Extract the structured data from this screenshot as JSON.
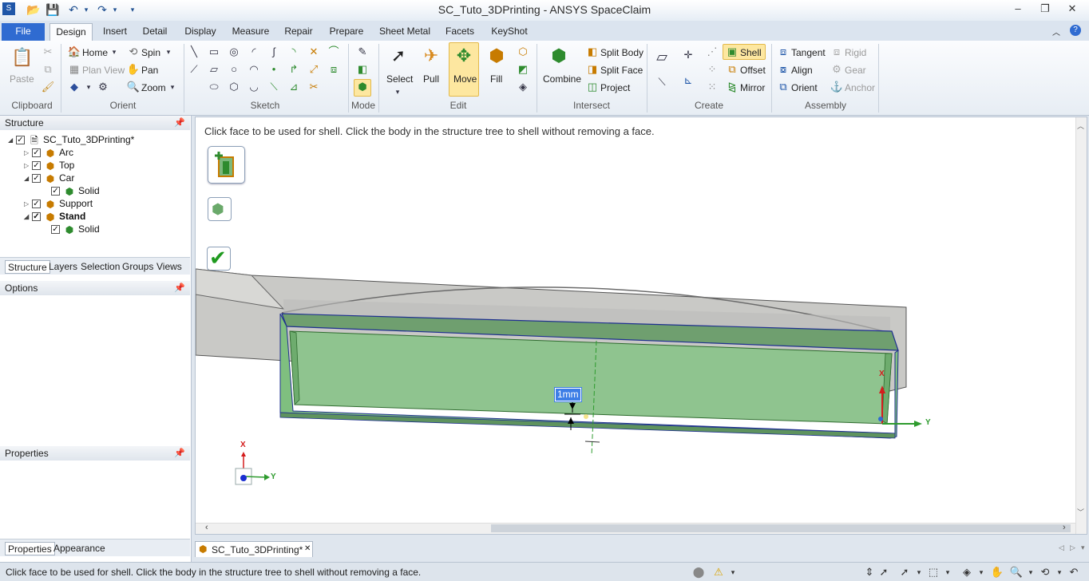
{
  "window": {
    "title": "SC_Tuto_3DPrinting - ANSYS SpaceClaim",
    "controls": {
      "minimize": "–",
      "restore": "❐",
      "close": "✕"
    }
  },
  "quick_access": [
    "save-icon",
    "open-icon",
    "undo-icon",
    "redo-icon",
    "customize-icon"
  ],
  "ribbon_tabs": [
    "File",
    "Design",
    "Insert",
    "Detail",
    "Display",
    "Measure",
    "Repair",
    "Prepare",
    "Sheet Metal",
    "Facets",
    "KeyShot"
  ],
  "active_tab": "Design",
  "ribbon": {
    "clipboard": {
      "label": "Clipboard",
      "paste": "Paste"
    },
    "orient": {
      "label": "Orient",
      "home": "Home",
      "spin": "Spin",
      "plan_view": "Plan View",
      "pan": "Pan",
      "zoom": "Zoom"
    },
    "sketch": {
      "label": "Sketch"
    },
    "mode": {
      "label": "Mode"
    },
    "edit": {
      "label": "Edit",
      "select": "Select",
      "pull": "Pull",
      "move": "Move",
      "fill": "Fill"
    },
    "intersect": {
      "label": "Intersect",
      "combine": "Combine",
      "split_body": "Split Body",
      "split_face": "Split Face",
      "project": "Project"
    },
    "create": {
      "label": "Create",
      "shell": "Shell",
      "offset": "Offset",
      "mirror": "Mirror"
    },
    "assembly": {
      "label": "Assembly",
      "tangent": "Tangent",
      "align": "Align",
      "orient": "Orient",
      "rigid": "Rigid",
      "gear": "Gear",
      "anchor": "Anchor"
    }
  },
  "structure": {
    "title": "Structure",
    "root": "SC_Tuto_3DPrinting*",
    "items": [
      {
        "label": "Arc"
      },
      {
        "label": "Top"
      },
      {
        "label": "Car"
      },
      {
        "label": "Solid"
      },
      {
        "label": "Support"
      },
      {
        "label": "Stand"
      },
      {
        "label": "Solid"
      }
    ],
    "tabs": [
      "Structure",
      "Layers",
      "Selection",
      "Groups",
      "Views"
    ]
  },
  "options": {
    "title": "Options"
  },
  "properties": {
    "title": "Properties",
    "tabs": [
      "Properties",
      "Appearance"
    ]
  },
  "viewport": {
    "hint": "Click face to be used for shell. Click the body in the structure tree to shell without removing a face.",
    "dimension": "1mm",
    "axis_x": "X",
    "axis_y": "Y"
  },
  "document_tab": {
    "label": "SC_Tuto_3DPrinting*",
    "close": "✕"
  },
  "status": {
    "text": "Click face to be used for shell. Click the body in the structure tree to shell without removing a face."
  },
  "colors": {
    "accent": "#2f6bd1",
    "model_green": "#8fc48f",
    "model_gray": "#c9c9c6",
    "highlight": "#fde7a0"
  }
}
